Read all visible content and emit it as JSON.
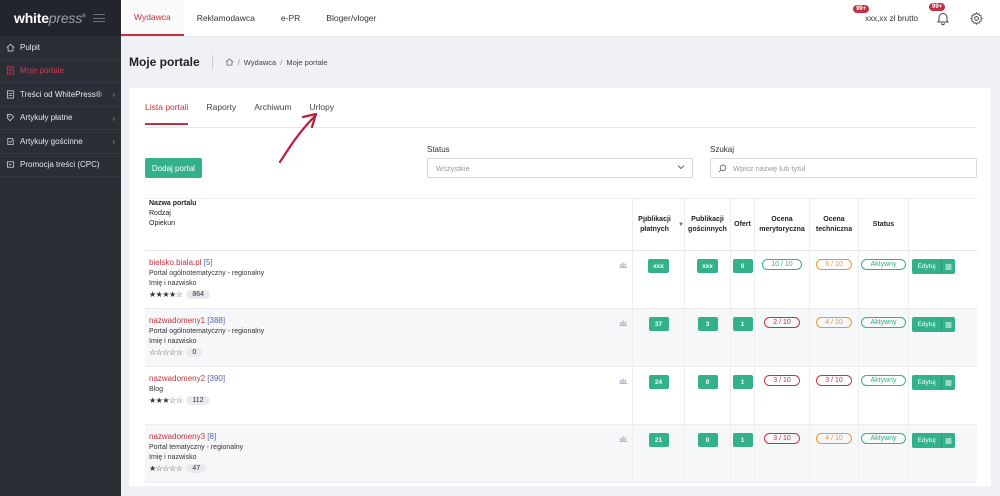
{
  "brand": {
    "logo_part1": "white",
    "logo_part2": "press",
    "logo_reg": "®"
  },
  "sidebar": {
    "items": [
      {
        "label": "Pulpit",
        "icon": "home-icon",
        "active": false,
        "chevron": false
      },
      {
        "label": "Moje portale",
        "icon": "portal-icon",
        "active": true,
        "chevron": false
      },
      {
        "label": "Treści od WhitePress®",
        "icon": "content-icon",
        "active": false,
        "chevron": true
      },
      {
        "label": "Artykuły płatne",
        "icon": "tag-icon",
        "active": false,
        "chevron": true
      },
      {
        "label": "Artykuły gościnne",
        "icon": "guest-icon",
        "active": false,
        "chevron": true
      },
      {
        "label": "Promocja treści (CPC)",
        "icon": "promo-icon",
        "active": false,
        "chevron": false
      }
    ]
  },
  "topnav": {
    "tabs": [
      {
        "label": "Wydawca",
        "active": true
      },
      {
        "label": "Reklamodawca",
        "active": false
      },
      {
        "label": "e-PR",
        "active": false
      },
      {
        "label": "Bloger/vloger",
        "active": false
      }
    ],
    "balance": "xxx,xx zł brutto",
    "balance_badge": "99+",
    "bell_badge": "99+"
  },
  "page": {
    "title": "Moje portale",
    "breadcrumb": [
      "Wydawca",
      "Moje portale"
    ]
  },
  "tabs": [
    {
      "label": "Lista portali",
      "active": true
    },
    {
      "label": "Raporty",
      "active": false
    },
    {
      "label": "Archiwum",
      "active": false
    },
    {
      "label": "Urlopy",
      "active": false
    }
  ],
  "filters": {
    "add_button": "Dodaj portal",
    "status_label": "Status",
    "status_value": "Wszystkie",
    "search_label": "Szukaj",
    "search_placeholder": "Wpisz nazwę lub tytuł"
  },
  "table": {
    "headers": {
      "name": "Nazwa portalu",
      "type": "Rodzaj",
      "owner": "Opiekun",
      "pub": "Publikacji płatnych",
      "gosc": "Publikacji gościnnych",
      "ofert": "Ofert",
      "mer": "Ocena merytoryczna",
      "tech": "Ocena techniczna",
      "status": "Status"
    },
    "rows": [
      {
        "name": "bielsko.biala.pl",
        "id": "[5]",
        "type": "Portal ogólnotematyczny - regionalny",
        "owner": "Imię i nazwisko",
        "stars": "★★★★☆",
        "count": "864",
        "pub": "xxx",
        "gosc": "xxx",
        "ofert": "6",
        "mer": "10 / 10",
        "mer_color": "green",
        "tech": "6 / 10",
        "tech_color": "orange",
        "status": "Aktywny",
        "edit": "Edytuj"
      },
      {
        "name": "nazwadomeny1",
        "id": "[388]",
        "type": "Portal ogólnotematyczny - regionalny",
        "owner": "Imię i nazwisko",
        "stars": "☆☆☆☆☆",
        "count": "0",
        "pub": "37",
        "gosc": "3",
        "ofert": "1",
        "mer": "2 / 10",
        "mer_color": "red",
        "tech": "4 / 10",
        "tech_color": "orange",
        "status": "Aktywny",
        "edit": "Edytuj"
      },
      {
        "name": "nazwadomeny2",
        "id": "[390]",
        "type": "Blog",
        "owner": "",
        "stars": "★★★☆☆",
        "count": "112",
        "pub": "24",
        "gosc": "0",
        "ofert": "1",
        "mer": "3 / 10",
        "mer_color": "red",
        "tech": "3 / 10",
        "tech_color": "red",
        "status": "Aktywny",
        "edit": "Edytuj"
      },
      {
        "name": "nazwadomeny3",
        "id": "[8]",
        "type": "Portal tematyczny - regionalny",
        "owner": "Imię i nazwisko",
        "stars": "★☆☆☆☆",
        "count": "47",
        "pub": "21",
        "gosc": "0",
        "ofert": "1",
        "mer": "3 / 10",
        "mer_color": "red",
        "tech": "4 / 10",
        "tech_color": "orange",
        "status": "Aktywny",
        "edit": "Edytuj"
      }
    ]
  },
  "colors": {
    "accent": "#c4323f",
    "green": "#33b18a",
    "orange": "#e89933",
    "sidebar": "#2b2d37"
  }
}
